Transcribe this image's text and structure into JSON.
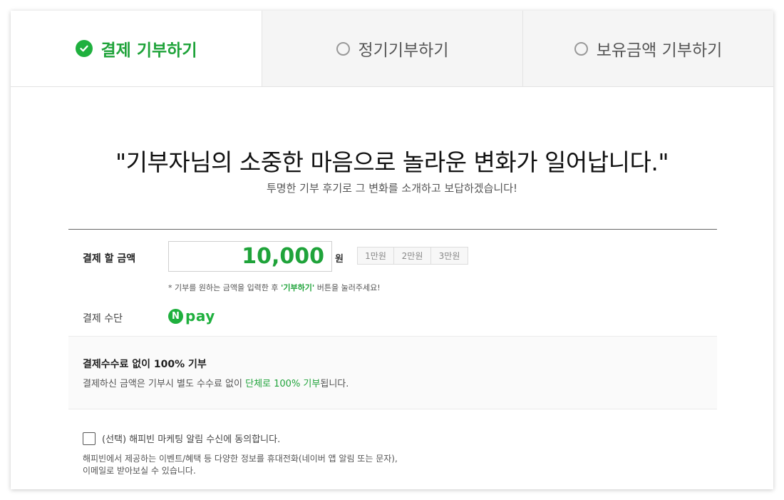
{
  "tabs": [
    {
      "label": "결제 기부하기",
      "selected": true
    },
    {
      "label": "정기기부하기",
      "selected": false
    },
    {
      "label": "보유금액 기부하기",
      "selected": false
    }
  ],
  "headline": "\"기부자님의 소중한 마음으로 놀라운 변화가 일어납니다.\"",
  "subline": "투명한 기부 후기로 그 변화를 소개하고 보답하겠습니다!",
  "amount": {
    "label": "결제 할 금액",
    "value": "10,000",
    "unit": "원",
    "quick_buttons": [
      "1만원",
      "2만원",
      "3만원"
    ],
    "hint_prefix": "* 기부를 원하는 금액을 입력한 후 ",
    "hint_highlight": "'기부하기'",
    "hint_suffix": " 버튼을 눌러주세요!"
  },
  "payment_method": {
    "label": "결제 수단",
    "logo_letter": "N",
    "logo_text": "pay"
  },
  "fee_notice": {
    "title": "결제수수료 없이 100% 기부",
    "desc_prefix": "결제하신 금액은 기부시 별도 수수료 없이 ",
    "desc_highlight": "단체로 100% 기부",
    "desc_suffix": "됩니다."
  },
  "consent": {
    "label": "(선택) 해피빈 마케팅 알림 수신에 동의합니다.",
    "checked": false,
    "desc_line1": "해피빈에서 제공하는 이벤트/혜택 등 다양한 정보를 휴대전화(네이버 앱 알림 또는 문자),",
    "desc_line2": "이메일로 받아보실 수 있습니다."
  },
  "colors": {
    "accent": "#1fa33a",
    "npay_green": "#1fb03e"
  },
  "icons": {
    "selected_tab": "check-circle-icon",
    "unselected_tab": "radio-empty-icon"
  }
}
